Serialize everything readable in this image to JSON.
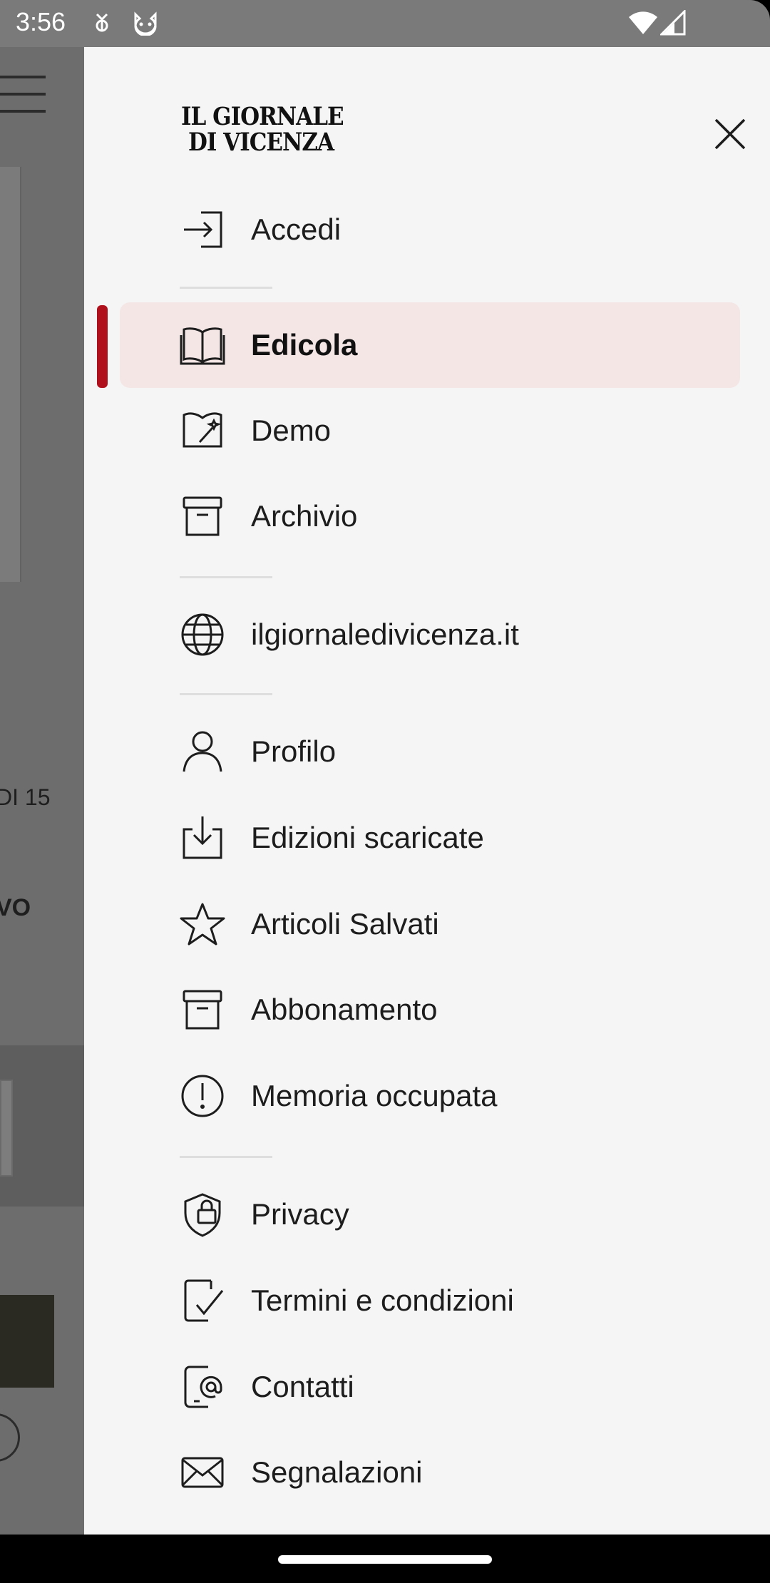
{
  "status_bar": {
    "time": "3:56",
    "icons": [
      "bug-report-icon",
      "cat-face-icon",
      "wifi-icon",
      "signal-icon"
    ]
  },
  "background_app": {
    "text_fragment_1": "DI 15",
    "text_fragment_2": "VO"
  },
  "drawer": {
    "logo_line1": "IL GIORNALE",
    "logo_line2": "DI VICENZA",
    "close_icon": "close-icon",
    "accent_color": "#b0101c",
    "items": [
      {
        "label": "Accedi",
        "icon": "login-arrow-icon"
      },
      {
        "label": "Edicola",
        "icon": "open-book-icon",
        "active": true
      },
      {
        "label": "Demo",
        "icon": "magic-wand-book-icon"
      },
      {
        "label": "Archivio",
        "icon": "archive-box-icon"
      },
      {
        "label": "ilgiornaledivicenza.it",
        "icon": "globe-icon"
      },
      {
        "label": "Profilo",
        "icon": "person-icon"
      },
      {
        "label": "Edizioni scaricate",
        "icon": "download-tray-icon"
      },
      {
        "label": "Articoli Salvati",
        "icon": "star-icon"
      },
      {
        "label": "Abbonamento",
        "icon": "archive-box-icon"
      },
      {
        "label": "Memoria occupata",
        "icon": "alert-circle-icon"
      },
      {
        "label": "Privacy",
        "icon": "shield-lock-icon"
      },
      {
        "label": "Termini e condizioni",
        "icon": "document-check-icon"
      },
      {
        "label": "Contatti",
        "icon": "phone-at-icon"
      },
      {
        "label": "Segnalazioni",
        "icon": "envelope-icon"
      }
    ]
  }
}
